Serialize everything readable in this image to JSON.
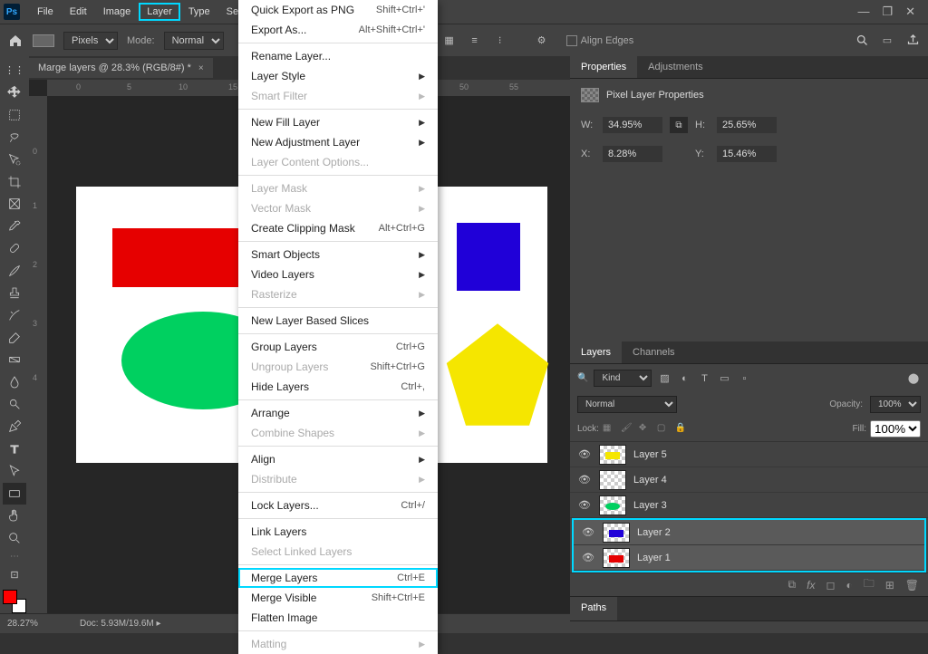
{
  "menubar": {
    "items": [
      "File",
      "Edit",
      "Image",
      "Layer",
      "Type",
      "Sel"
    ],
    "active_index": 3
  },
  "window_controls": {
    "min": "—",
    "max": "❐",
    "close": "✕"
  },
  "optionsbar": {
    "units_select": "Pixels",
    "mode_label": "Mode:",
    "mode_value": "Normal",
    "align_edges_label": "Align Edges"
  },
  "document": {
    "tab_title": "Marge layers @ 28.3% (RGB/8#) *",
    "tab_close": "×"
  },
  "rulers": {
    "h": [
      "0",
      "5",
      "10",
      "15",
      "50",
      "55"
    ],
    "v": [
      "0",
      "1",
      "2",
      "3",
      "4"
    ]
  },
  "dropdown": {
    "groups": [
      [
        {
          "label": "Quick Export as PNG",
          "kb": "Shift+Ctrl+'",
          "enabled": true
        },
        {
          "label": "Export As...",
          "kb": "Alt+Shift+Ctrl+'",
          "enabled": true
        }
      ],
      [
        {
          "label": "Rename Layer...",
          "enabled": true
        },
        {
          "label": "Layer Style",
          "enabled": true,
          "sub": true
        },
        {
          "label": "Smart Filter",
          "enabled": false,
          "sub": true
        }
      ],
      [
        {
          "label": "New Fill Layer",
          "enabled": true,
          "sub": true
        },
        {
          "label": "New Adjustment Layer",
          "enabled": true,
          "sub": true
        },
        {
          "label": "Layer Content Options...",
          "enabled": false
        }
      ],
      [
        {
          "label": "Layer Mask",
          "enabled": false,
          "sub": true
        },
        {
          "label": "Vector Mask",
          "enabled": false,
          "sub": true
        },
        {
          "label": "Create Clipping Mask",
          "kb": "Alt+Ctrl+G",
          "enabled": true
        }
      ],
      [
        {
          "label": "Smart Objects",
          "enabled": true,
          "sub": true
        },
        {
          "label": "Video Layers",
          "enabled": true,
          "sub": true
        },
        {
          "label": "Rasterize",
          "enabled": false,
          "sub": true
        }
      ],
      [
        {
          "label": "New Layer Based Slices",
          "enabled": true
        }
      ],
      [
        {
          "label": "Group Layers",
          "kb": "Ctrl+G",
          "enabled": true
        },
        {
          "label": "Ungroup Layers",
          "kb": "Shift+Ctrl+G",
          "enabled": false
        },
        {
          "label": "Hide Layers",
          "kb": "Ctrl+,",
          "enabled": true
        }
      ],
      [
        {
          "label": "Arrange",
          "enabled": true,
          "sub": true
        },
        {
          "label": "Combine Shapes",
          "enabled": false,
          "sub": true
        }
      ],
      [
        {
          "label": "Align",
          "enabled": true,
          "sub": true
        },
        {
          "label": "Distribute",
          "enabled": false,
          "sub": true
        }
      ],
      [
        {
          "label": "Lock Layers...",
          "kb": "Ctrl+/",
          "enabled": true
        }
      ],
      [
        {
          "label": "Link Layers",
          "enabled": true
        },
        {
          "label": "Select Linked Layers",
          "enabled": false
        }
      ],
      [
        {
          "label": "Merge Layers",
          "kb": "Ctrl+E",
          "enabled": true,
          "highlight": true
        },
        {
          "label": "Merge Visible",
          "kb": "Shift+Ctrl+E",
          "enabled": true
        },
        {
          "label": "Flatten Image",
          "enabled": true
        }
      ],
      [
        {
          "label": "Matting",
          "enabled": false,
          "sub": true
        }
      ]
    ]
  },
  "properties_panel": {
    "tabs": [
      "Properties",
      "Adjustments"
    ],
    "active_tab": 0,
    "title": "Pixel Layer Properties",
    "w_label": "W:",
    "w_value": "34.95%",
    "h_label": "H:",
    "h_value": "25.65%",
    "x_label": "X:",
    "x_value": "8.28%",
    "y_label": "Y:",
    "y_value": "15.46%"
  },
  "layers_panel": {
    "tabs": [
      "Layers",
      "Channels"
    ],
    "active_tab": 0,
    "filter_label": "Kind",
    "blend_mode": "Normal",
    "opacity_label": "Opacity:",
    "opacity_value": "100%",
    "lock_label": "Lock:",
    "fill_label": "Fill:",
    "fill_value": "100%",
    "layers": [
      {
        "name": "Layer 5",
        "visible": true,
        "color": "#f5e600",
        "selected": false
      },
      {
        "name": "Layer 4",
        "visible": true,
        "color": null,
        "selected": false
      },
      {
        "name": "Layer 3",
        "visible": true,
        "color": "#00d060",
        "selected": false
      },
      {
        "name": "Layer 2",
        "visible": true,
        "color": "#2000d8",
        "selected": true
      },
      {
        "name": "Layer 1",
        "visible": true,
        "color": "#e60000",
        "selected": true
      }
    ]
  },
  "paths_panel": {
    "tab": "Paths"
  },
  "statusbar": {
    "zoom": "28.27%",
    "doc_label": "Doc:",
    "doc_info": "5.93M/19.6M"
  },
  "colors": {
    "highlight": "#00d8ff"
  }
}
